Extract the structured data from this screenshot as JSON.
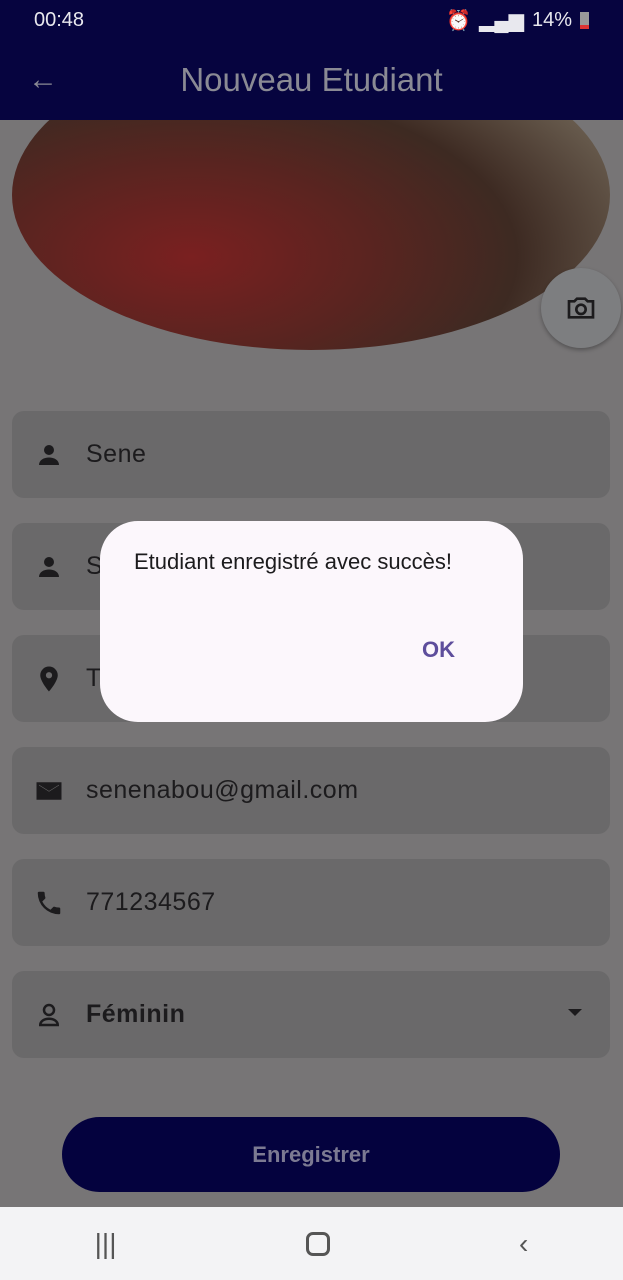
{
  "status_bar": {
    "time": "00:48",
    "battery": "14%"
  },
  "app_bar": {
    "title": "Nouveau Etudiant"
  },
  "form": {
    "nom": "Sene",
    "prenom": "S",
    "adresse": "T",
    "email": "senenabou@gmail.com",
    "telephone": "771234567",
    "genre": "Féminin"
  },
  "save_label": "Enregistrer",
  "dialog": {
    "message": "Etudiant enregistré avec succès!",
    "ok_label": "OK"
  }
}
